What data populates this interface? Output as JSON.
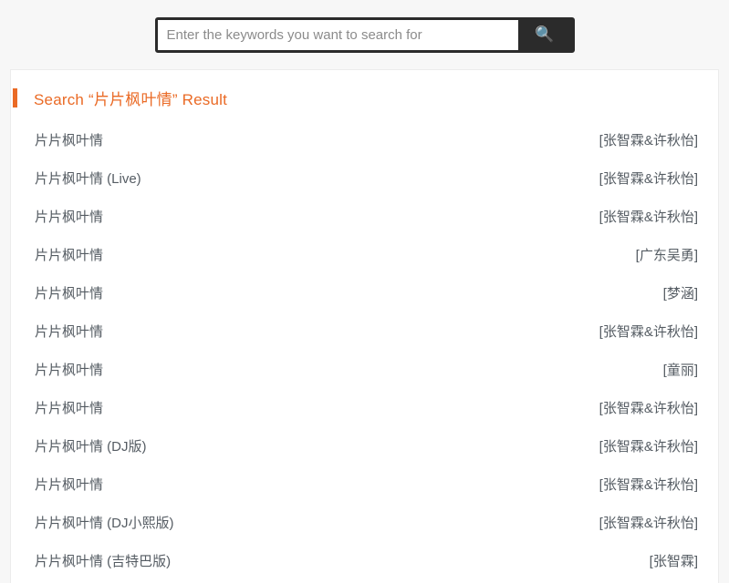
{
  "search": {
    "placeholder": "Enter the keywords you want to search for",
    "value": "",
    "button_icon": "search-icon",
    "button_glyph": "🔍"
  },
  "result": {
    "header_prefix": "Search",
    "query": "片片枫叶情",
    "header_text": "Search “片片枫叶情” Result",
    "accent_color": "#ea6a25",
    "rows": [
      {
        "title": "片片枫叶情",
        "artist": "[张智霖&许秋怡]"
      },
      {
        "title": "片片枫叶情 (Live)",
        "artist": "[张智霖&许秋怡]"
      },
      {
        "title": "片片枫叶情",
        "artist": "[张智霖&许秋怡]"
      },
      {
        "title": "片片枫叶情",
        "artist": "[广东吴勇]"
      },
      {
        "title": "片片枫叶情",
        "artist": "[梦涵]"
      },
      {
        "title": "片片枫叶情",
        "artist": "[张智霖&许秋怡]"
      },
      {
        "title": "片片枫叶情",
        "artist": "[童丽]"
      },
      {
        "title": "片片枫叶情",
        "artist": "[张智霖&许秋怡]"
      },
      {
        "title": "片片枫叶情 (DJ版)",
        "artist": "[张智霖&许秋怡]"
      },
      {
        "title": "片片枫叶情",
        "artist": "[张智霖&许秋怡]"
      },
      {
        "title": "片片枫叶情 (DJ小熙版)",
        "artist": "[张智霖&许秋怡]"
      },
      {
        "title": "片片枫叶情 (吉特巴版)",
        "artist": "[张智霖]"
      }
    ]
  }
}
